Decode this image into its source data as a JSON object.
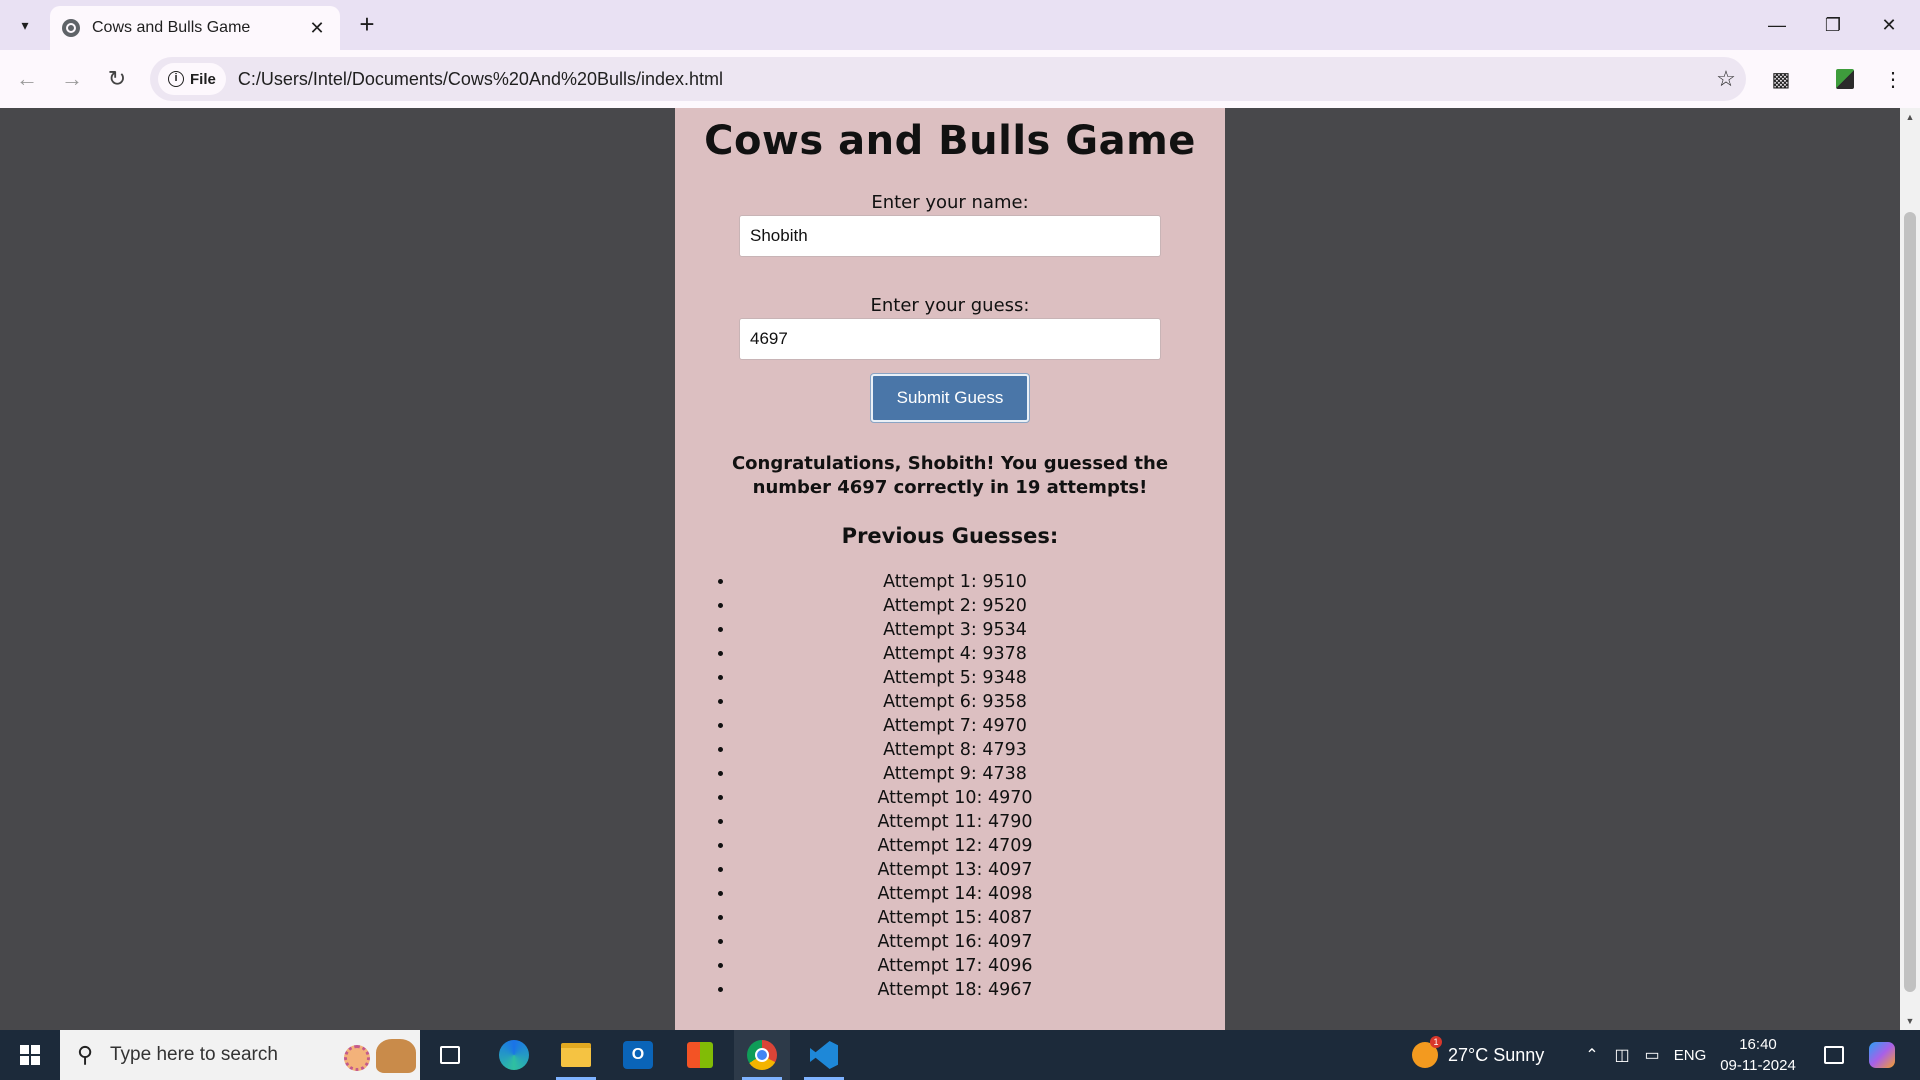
{
  "browser": {
    "tab_title": "Cows and Bulls Game",
    "tab_close": "✕",
    "new_tab": "+",
    "site_chip": "File",
    "url": "C:/Users/Intel/Documents/Cows%20And%20Bulls/index.html"
  },
  "page": {
    "title": "Cows and Bulls Game",
    "name_label": "Enter your name:",
    "name_value": "Shobith",
    "guess_label": "Enter your guess:",
    "guess_value": "4697",
    "submit_label": "Submit Guess",
    "result_text": "Congratulations, Shobith! You guessed the number 4697 correctly in 19 attempts!",
    "previous_heading": "Previous Guesses:",
    "attempts": [
      "Attempt 1: 9510",
      "Attempt 2: 9520",
      "Attempt 3: 9534",
      "Attempt 4: 9378",
      "Attempt 5: 9348",
      "Attempt 6: 9358",
      "Attempt 7: 4970",
      "Attempt 8: 4793",
      "Attempt 9: 4738",
      "Attempt 10: 4970",
      "Attempt 11: 4790",
      "Attempt 12: 4709",
      "Attempt 13: 4097",
      "Attempt 14: 4098",
      "Attempt 15: 4087",
      "Attempt 16: 4097",
      "Attempt 17: 4096",
      "Attempt 18: 4967"
    ]
  },
  "taskbar": {
    "search_placeholder": "Type here to search",
    "weather": "27°C  Sunny",
    "weather_badge": "1",
    "language": "ENG",
    "time": "16:40",
    "date": "09-11-2024"
  },
  "colors": {
    "card_background": "#dcbfc1",
    "page_background": "#48484b",
    "submit_button": "#4a76a8"
  }
}
